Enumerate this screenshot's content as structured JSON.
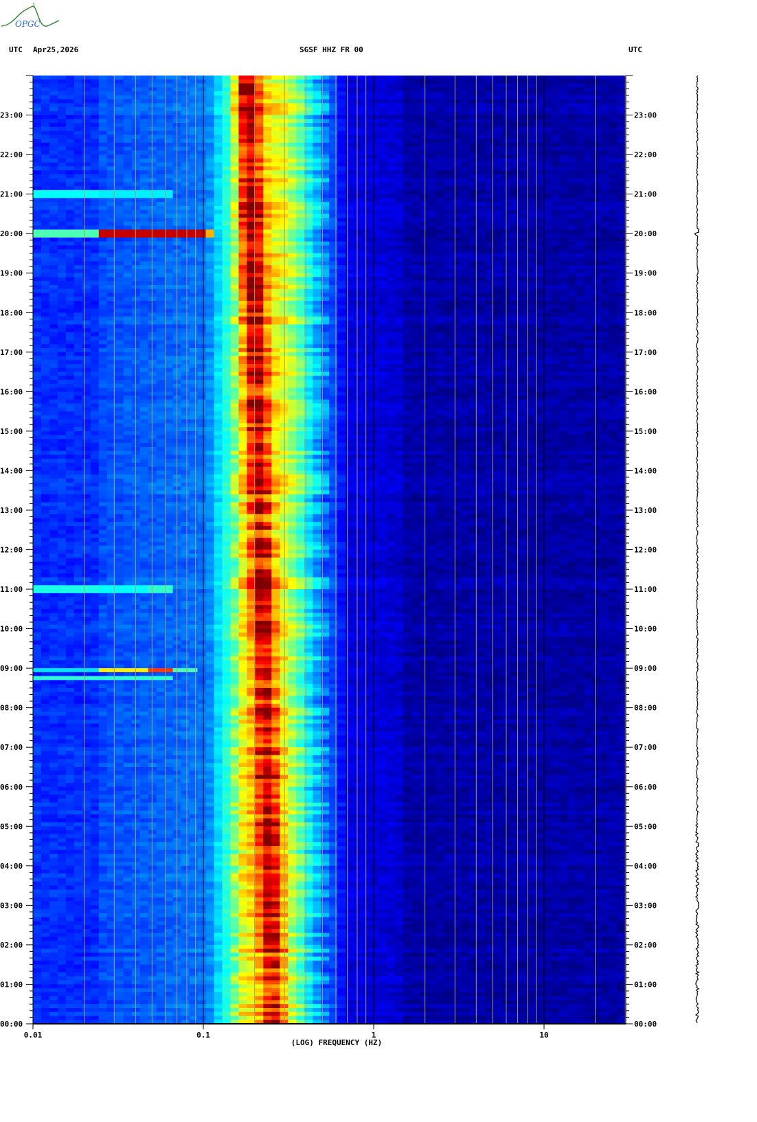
{
  "logo": {
    "text": "OPGC"
  },
  "header": {
    "left_tz": "UTC",
    "date": "Apr25,2026",
    "station": "SGSF HHZ FR 00",
    "right_tz": "UTC"
  },
  "chart_data": {
    "type": "heatmap",
    "title": "SGSF HHZ FR 00",
    "xlabel": "(LOG) FREQUENCY (HZ)",
    "ylabel": "UTC",
    "xscale": "log",
    "xlim": [
      0.01,
      30
    ],
    "ylim": [
      0,
      24
    ],
    "x_ticks": [
      {
        "value": 0.01,
        "label": "0.01"
      },
      {
        "value": 0.1,
        "label": "0.1"
      },
      {
        "value": 1,
        "label": "1"
      },
      {
        "value": 10,
        "label": "10"
      }
    ],
    "y_ticks": [
      "00:00",
      "01:00",
      "02:00",
      "03:00",
      "04:00",
      "05:00",
      "06:00",
      "07:00",
      "08:00",
      "09:00",
      "10:00",
      "11:00",
      "12:00",
      "13:00",
      "14:00",
      "15:00",
      "16:00",
      "17:00",
      "18:00",
      "19:00",
      "20:00",
      "21:00",
      "22:00",
      "23:00"
    ],
    "colormap": "jet",
    "grid": true,
    "intensity_profile": [
      [
        0.01,
        0.17
      ],
      [
        0.025,
        0.17
      ],
      [
        0.0251,
        0.2
      ],
      [
        0.1,
        0.24
      ],
      [
        0.12,
        0.3
      ],
      [
        0.125,
        0.4
      ],
      [
        0.15,
        0.42
      ],
      [
        0.155,
        0.6
      ],
      [
        0.2,
        0.66
      ],
      [
        0.3,
        0.6
      ],
      [
        0.36,
        0.5
      ],
      [
        0.42,
        0.38
      ],
      [
        0.5,
        0.27
      ],
      [
        0.6,
        0.18
      ],
      [
        0.7,
        0.1
      ],
      [
        1.4,
        0.08
      ],
      [
        1.5,
        0.04
      ],
      [
        30,
        0.04
      ]
    ],
    "peak": {
      "freq_at_00h": 0.26,
      "freq_at_24h": 0.18,
      "amplitude": 0.34
    },
    "events": [
      {
        "hour": 20.0,
        "segments": [
          [
            0.01,
            0.025,
            0.45
          ],
          [
            0.025,
            0.1,
            0.93
          ],
          [
            0.1,
            0.12,
            0.7
          ]
        ]
      },
      {
        "hour": 21.0,
        "segments": [
          [
            0.01,
            0.025,
            0.38
          ],
          [
            0.025,
            0.07,
            0.36
          ]
        ]
      },
      {
        "hour": 11.0,
        "segments": [
          [
            0.01,
            0.025,
            0.4
          ],
          [
            0.025,
            0.05,
            0.38
          ],
          [
            0.05,
            0.07,
            0.42
          ]
        ]
      },
      {
        "hour": 8.95,
        "segments": [
          [
            0.01,
            0.025,
            0.35
          ],
          [
            0.025,
            0.05,
            0.64
          ],
          [
            0.05,
            0.07,
            0.82
          ],
          [
            0.07,
            0.09,
            0.45
          ]
        ]
      },
      {
        "hour": 8.75,
        "segments": [
          [
            0.01,
            0.025,
            0.42
          ],
          [
            0.025,
            0.07,
            0.42
          ]
        ]
      }
    ]
  }
}
